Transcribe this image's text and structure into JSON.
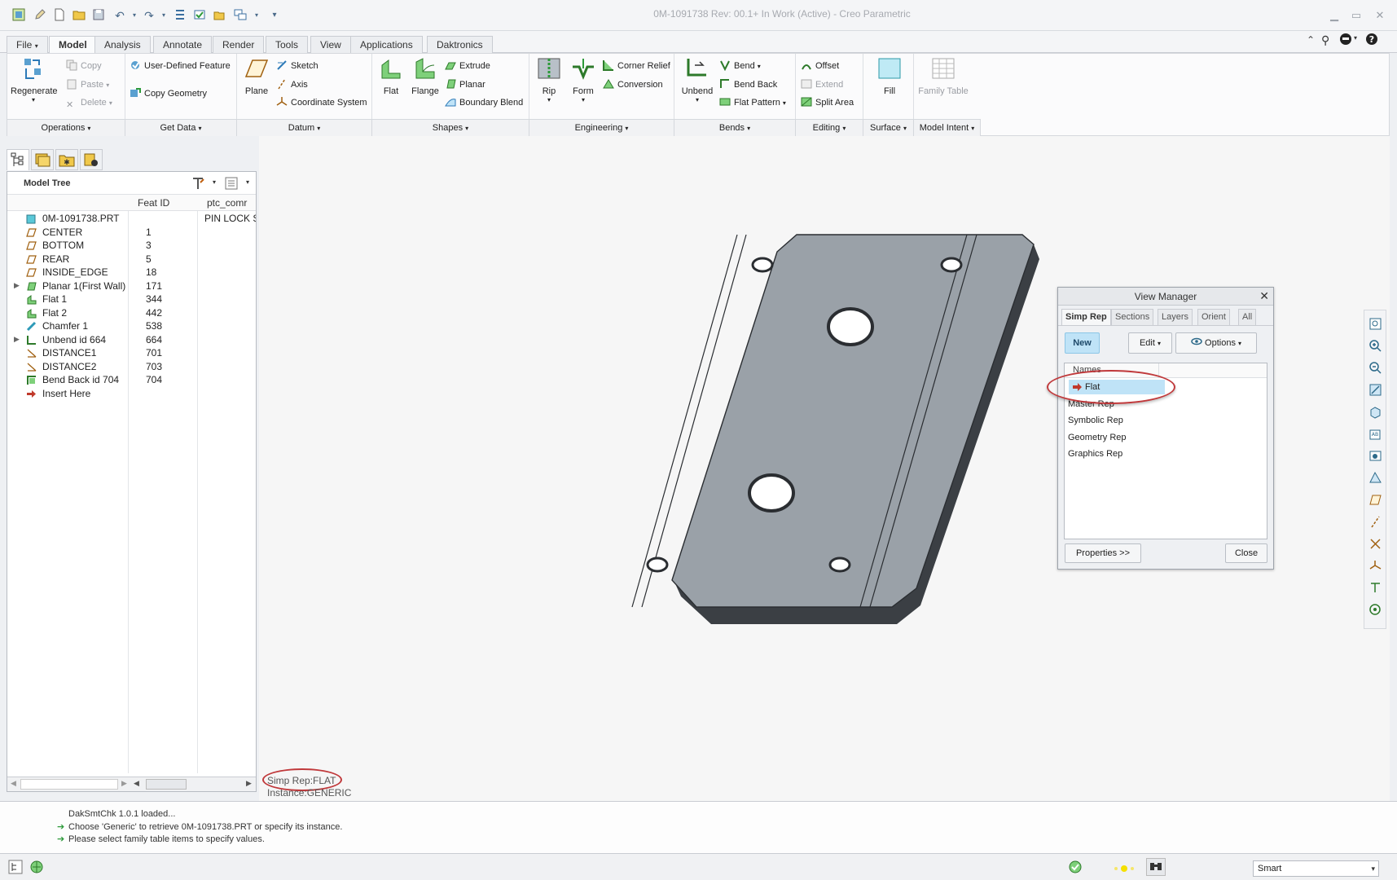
{
  "window": {
    "title": "0M-1091738 Rev: 00.1+ In Work  (Active) - Creo Parametric"
  },
  "tabs": [
    {
      "label": "File"
    },
    {
      "label": "Model"
    },
    {
      "label": "Analysis"
    },
    {
      "label": "Annotate"
    },
    {
      "label": "Render"
    },
    {
      "label": "Tools"
    },
    {
      "label": "View"
    },
    {
      "label": "Applications"
    },
    {
      "label": "Daktronics"
    }
  ],
  "ribbon": {
    "operations": {
      "regenerate": "Regenerate",
      "copy": "Copy",
      "paste": "Paste",
      "delete": "Delete",
      "footer": "Operations"
    },
    "get_data": {
      "udf": "User-Defined Feature",
      "copy_geometry": "Copy Geometry",
      "footer": "Get Data"
    },
    "datum": {
      "plane": "Plane",
      "sketch": "Sketch",
      "axis": "Axis",
      "csys": "Coordinate System",
      "footer": "Datum"
    },
    "shapes": {
      "flat": "Flat",
      "flange": "Flange",
      "extrude": "Extrude",
      "planar": "Planar",
      "boundary_blend": "Boundary Blend",
      "footer": "Shapes"
    },
    "engineering": {
      "rip": "Rip",
      "form": "Form",
      "corner_relief": "Corner Relief",
      "conversion": "Conversion",
      "footer": "Engineering"
    },
    "bends": {
      "unbend": "Unbend",
      "bend": "Bend",
      "bend_back": "Bend Back",
      "flat_pattern": "Flat Pattern",
      "footer": "Bends"
    },
    "editing": {
      "offset": "Offset",
      "extend": "Extend",
      "split_area": "Split Area",
      "footer": "Editing"
    },
    "surface": {
      "fill": "Fill",
      "footer": "Surface"
    },
    "model_intent": {
      "family_table": "Family Table",
      "footer": "Model Intent"
    }
  },
  "model_tree": {
    "title": "Model Tree",
    "columns": [
      "Feat ID",
      "ptc_comr"
    ],
    "rows": [
      {
        "name": "0M-1091738.PRT",
        "id": "",
        "comment": "PIN LOCK S",
        "icon": "part-icon",
        "expandable": false
      },
      {
        "name": "CENTER",
        "id": "1",
        "comment": "",
        "icon": "datum-plane-icon",
        "expandable": false
      },
      {
        "name": "BOTTOM",
        "id": "3",
        "comment": "",
        "icon": "datum-plane-icon",
        "expandable": false
      },
      {
        "name": "REAR",
        "id": "5",
        "comment": "",
        "icon": "datum-plane-icon",
        "expandable": false
      },
      {
        "name": "INSIDE_EDGE",
        "id": "18",
        "comment": "",
        "icon": "datum-plane-icon",
        "expandable": false
      },
      {
        "name": "Planar 1(First Wall)",
        "id": "171",
        "comment": "",
        "icon": "planar-wall-icon",
        "expandable": true
      },
      {
        "name": "Flat 1",
        "id": "344",
        "comment": "",
        "icon": "flat-wall-icon",
        "expandable": false
      },
      {
        "name": "Flat 2",
        "id": "442",
        "comment": "",
        "icon": "flat-wall-icon",
        "expandable": false
      },
      {
        "name": "Chamfer 1",
        "id": "538",
        "comment": "",
        "icon": "chamfer-icon",
        "expandable": false
      },
      {
        "name": "Unbend id 664",
        "id": "664",
        "comment": "",
        "icon": "unbend-icon",
        "expandable": true
      },
      {
        "name": "DISTANCE1",
        "id": "701",
        "comment": "",
        "icon": "analysis-icon",
        "expandable": false
      },
      {
        "name": "DISTANCE2",
        "id": "703",
        "comment": "",
        "icon": "analysis-icon",
        "expandable": false
      },
      {
        "name": "Bend Back id 704",
        "id": "704",
        "comment": "",
        "icon": "bend-back-icon",
        "expandable": false
      },
      {
        "name": "Insert Here",
        "id": "",
        "comment": "",
        "icon": "insert-arrow-icon",
        "expandable": false
      }
    ]
  },
  "viewport": {
    "simp_rep": "Simp Rep:FLAT",
    "instance": "Instance:GENERIC"
  },
  "view_manager": {
    "title": "View Manager",
    "tabs": [
      "Simp Rep",
      "Sections",
      "Layers",
      "Orient",
      "All"
    ],
    "active_tab": "Simp Rep",
    "buttons": {
      "new": "New",
      "edit": "Edit",
      "options": "Options",
      "properties": "Properties >>",
      "close": "Close"
    },
    "list_header": "Names",
    "items": [
      "Flat",
      "Master Rep",
      "Symbolic Rep",
      "Geometry Rep",
      "Graphics Rep"
    ],
    "selected": "Flat"
  },
  "messages": [
    {
      "text": "DakSmtChk 1.0.1 loaded...",
      "arrow": false
    },
    {
      "text": "Choose 'Generic' to retrieve 0M-1091738.PRT or specify its instance.",
      "arrow": true
    },
    {
      "text": "Please select family table items to specify values.",
      "arrow": true
    }
  ],
  "status_bar": {
    "filter_value": "Smart"
  },
  "colors": {
    "accent_blue": "#bfe3f7",
    "highlight_red": "#c0393b",
    "part_face": "#9aa1a8",
    "part_edge": "#3b3f44"
  }
}
